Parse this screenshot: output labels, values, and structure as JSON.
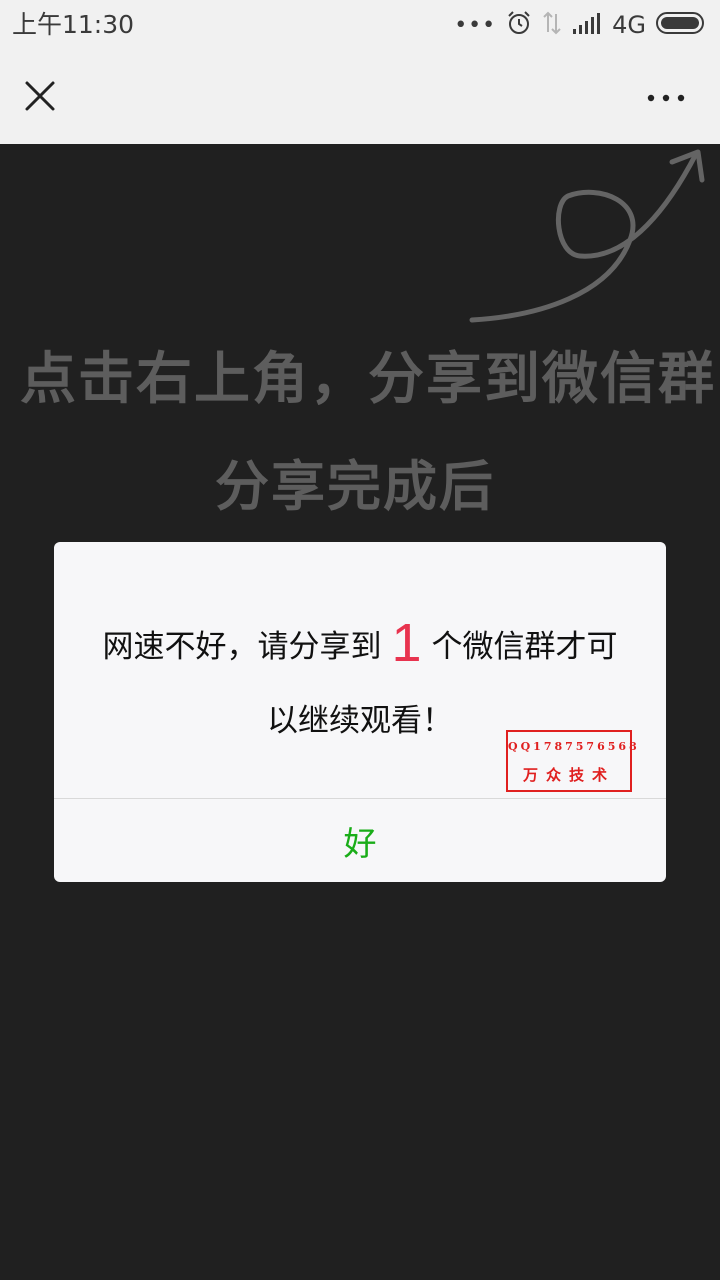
{
  "status_bar": {
    "time": "上午11:30",
    "dots": "•••",
    "network": "4G"
  },
  "title_bar": {
    "close_icon": "close-icon",
    "more_icon": "more-icon"
  },
  "hint": {
    "line1": "点击右上角，分享到微信群",
    "line2": "分享完成后",
    "arrow_icon": "curved-arrow-icon"
  },
  "dialog": {
    "message_before": "网速不好，请分享到",
    "count": "1",
    "message_after": "个微信群才可以继续观看！",
    "ok_label": "好",
    "stamp": {
      "qq": "QQ1787576568",
      "name": "万众技术"
    }
  },
  "colors": {
    "accent_green": "#1aad19",
    "count_red": "#e8334f",
    "stamp_red": "#e02020",
    "background_dark": "#202020"
  }
}
